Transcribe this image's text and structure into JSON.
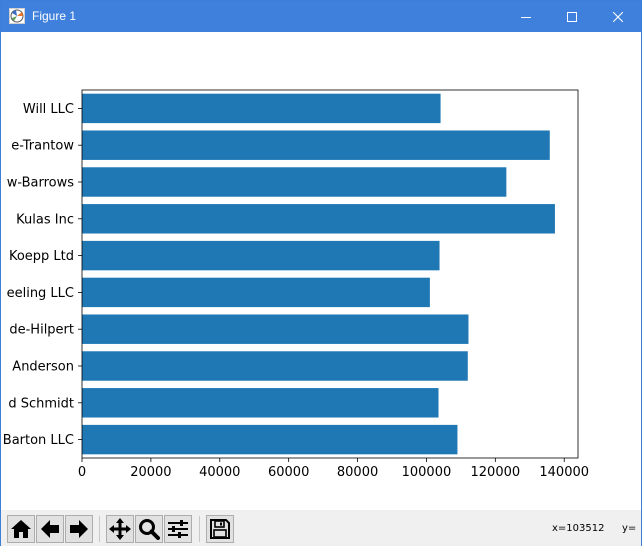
{
  "window": {
    "title": "Figure 1",
    "icon": "matplotlib-figure-icon",
    "controls": [
      "minimize-icon",
      "maximize-icon",
      "close-icon"
    ]
  },
  "chart_data": {
    "type": "bar",
    "orientation": "horizontal",
    "categories": [
      "Barton LLC",
      "d Schmidt",
      "Anderson",
      "de-Hilpert",
      "eeling LLC",
      "Koepp Ltd",
      "Kulas Inc",
      "w-Barrows",
      "e-Trantow",
      "Will LLC"
    ],
    "values": [
      109000,
      103500,
      112000,
      112200,
      101000,
      103800,
      137300,
      123200,
      135800,
      104100
    ],
    "xlim": [
      0,
      144000
    ],
    "xticks": [
      0,
      20000,
      40000,
      60000,
      80000,
      100000,
      120000,
      140000
    ],
    "xtick_labels": [
      "0",
      "20000",
      "40000",
      "60000",
      "80000",
      "100000",
      "120000",
      "140000"
    ],
    "bar_color": "#1f77b4",
    "grid": false,
    "legend": "none"
  },
  "toolbar": {
    "buttons": [
      {
        "icon": "home-icon",
        "name": "home-button"
      },
      {
        "icon": "back-arrow-icon",
        "name": "back-button"
      },
      {
        "icon": "forward-arrow-icon",
        "name": "forward-button"
      },
      {
        "icon": "pan-move-icon",
        "name": "pan-button"
      },
      {
        "icon": "zoom-magnifier-icon",
        "name": "zoom-button"
      },
      {
        "icon": "subplots-sliders-icon",
        "name": "configure-subplots-button"
      },
      {
        "icon": "save-floppy-icon",
        "name": "save-button"
      }
    ],
    "x_readout": "x=103512",
    "y_readout": "y="
  }
}
